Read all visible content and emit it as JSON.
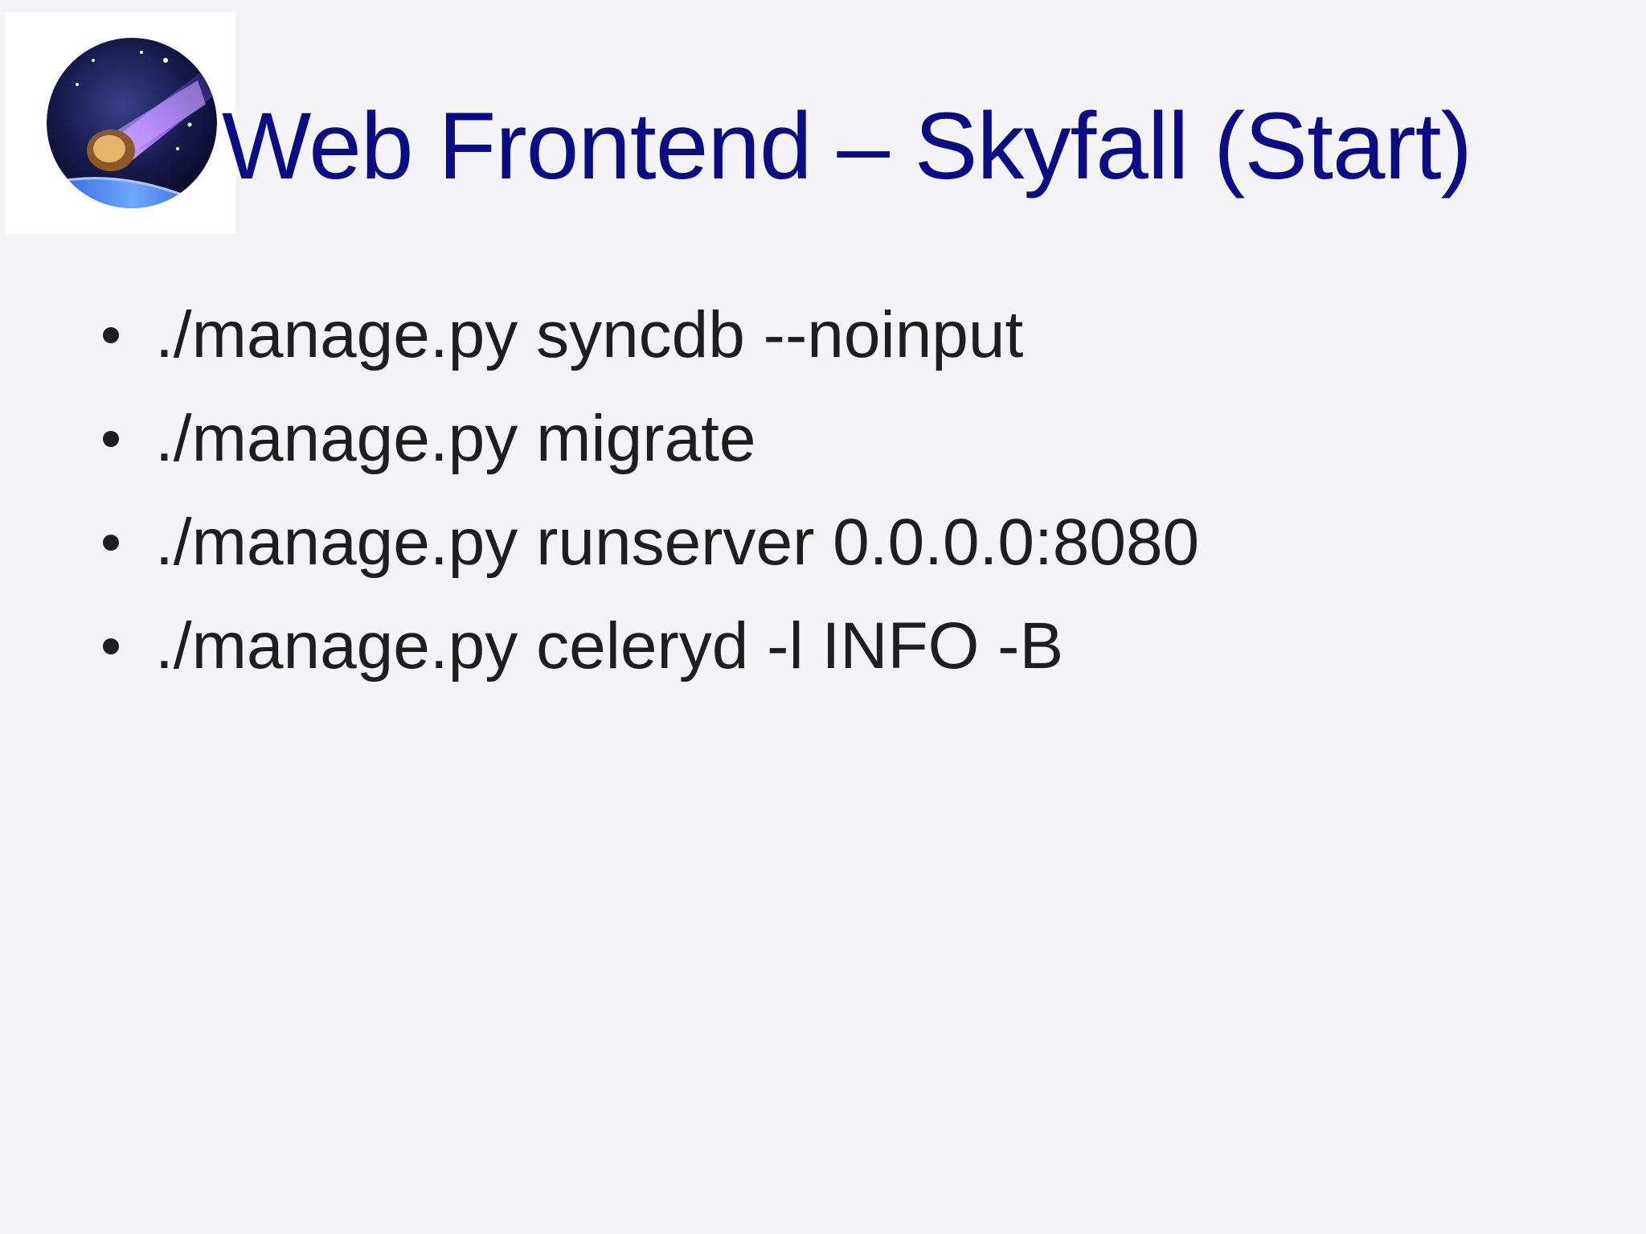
{
  "slide": {
    "title": "Web Frontend – Skyfall (Start)",
    "logo_icon": "meteor-icon",
    "colors": {
      "background": "#f4f3f5",
      "title": "#0c0b86",
      "text": "#1e1e1e"
    },
    "bullets": [
      "./manage.py syncdb --noinput",
      "./manage.py migrate",
      "./manage.py runserver 0.0.0.0:8080",
      "./manage.py celeryd -l INFO -B"
    ]
  }
}
